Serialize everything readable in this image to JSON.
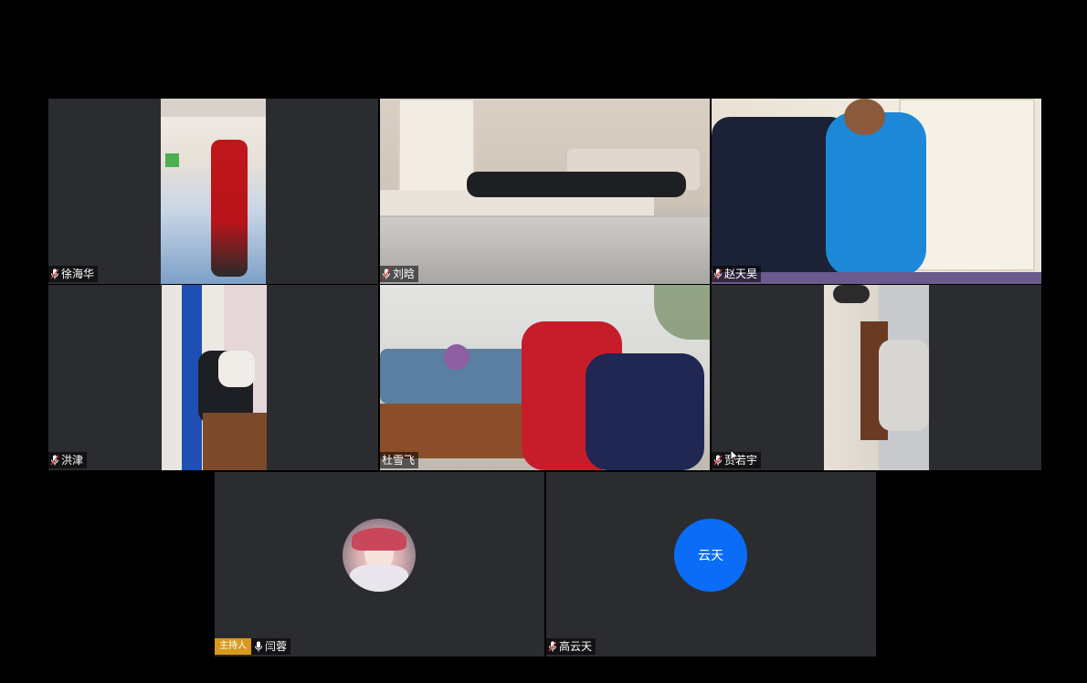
{
  "tiles": [
    {
      "id": "xu",
      "name": "徐海华",
      "mic": "muted"
    },
    {
      "id": "liu",
      "name": "刘晗",
      "mic": "muted"
    },
    {
      "id": "zhao",
      "name": "赵天昊",
      "mic": "muted"
    },
    {
      "id": "hong",
      "name": "洪津",
      "mic": "muted"
    },
    {
      "id": "du",
      "name": "杜雪飞",
      "mic": "none"
    },
    {
      "id": "jia",
      "name": "贾若宇",
      "mic": "muted"
    },
    {
      "id": "yan",
      "name": "闫蓉",
      "mic": "on",
      "badge": "主持人"
    },
    {
      "id": "gao",
      "name": "高云天",
      "mic": "muted",
      "avatar_text": "云天"
    }
  ],
  "colors": {
    "tile_bg": "#2b2c30",
    "background": "#000000",
    "avatar_blue": "#0a6cf7",
    "host_badge": "#d89a1c",
    "muted_red": "#e53935"
  }
}
